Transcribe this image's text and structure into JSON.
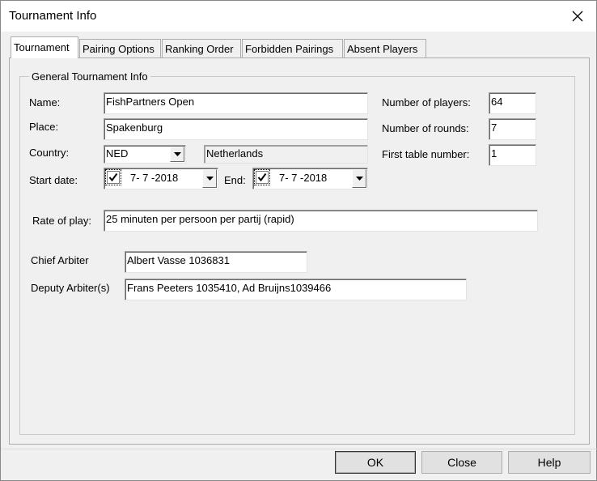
{
  "window": {
    "title": "Tournament Info"
  },
  "tabs": [
    {
      "label": "Tournament"
    },
    {
      "label": "Pairing Options"
    },
    {
      "label": "Ranking Order"
    },
    {
      "label": "Forbidden Pairings"
    },
    {
      "label": "Absent Players"
    }
  ],
  "general": {
    "legend": "General Tournament Info",
    "name_label": "Name:",
    "name_value": "FishPartners Open",
    "place_label": "Place:",
    "place_value": "Spakenburg",
    "country_label": "Country:",
    "country_code": "NED",
    "country_name": "Netherlands",
    "start_label": "Start date:",
    "start_value": "7- 7 -2018",
    "end_label": "End:",
    "end_value": "7- 7 -2018",
    "players_label": "Number of players:",
    "players_value": "64",
    "rounds_label": "Number of rounds:",
    "rounds_value": "7",
    "first_table_label": "First table number:",
    "first_table_value": "1",
    "rate_label": "Rate of play:",
    "rate_value": "25 minuten per persoon per partij (rapid)",
    "chief_label": "Chief Arbiter",
    "chief_value": "Albert Vasse 1036831",
    "deputy_label": "Deputy Arbiter(s)",
    "deputy_value": "Frans Peeters 1035410, Ad Bruijns1039466"
  },
  "buttons": {
    "ok": "OK",
    "close": "Close",
    "help": "Help"
  },
  "icons": {
    "close": "close-icon",
    "dropdown": "chevron-down-icon",
    "check": "checkmark-icon"
  }
}
